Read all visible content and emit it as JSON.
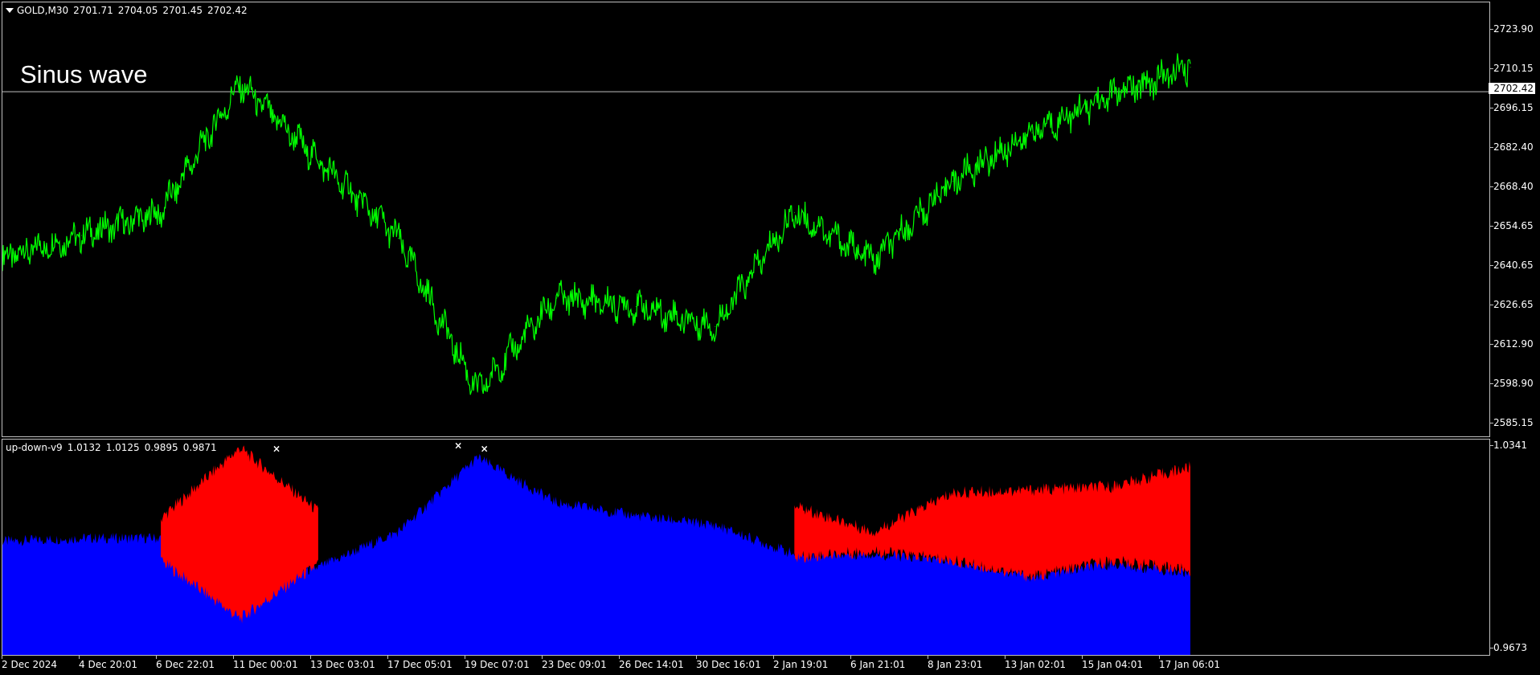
{
  "price_chart": {
    "symbol": "GOLD,M30",
    "ohlc": [
      "2701.71",
      "2704.05",
      "2701.45",
      "2702.42"
    ],
    "label": "Sinus wave",
    "current_price": "2702.42",
    "y_ticks": [
      "2723.90",
      "2710.15",
      "2696.15",
      "2682.40",
      "2668.40",
      "2654.65",
      "2640.65",
      "2626.65",
      "2612.90",
      "2598.90",
      "2585.15"
    ],
    "line_color": "#00ff00"
  },
  "indicator": {
    "name": "up-down-v9",
    "values": [
      "1.0132",
      "1.0125",
      "0.9895",
      "0.9871"
    ],
    "y_max": "1.0341",
    "y_min": "0.9673",
    "up_color": "#0000ff",
    "down_color": "#ff0000",
    "marker_color": "#ffffff"
  },
  "x_axis": {
    "labels": [
      "2 Dec 2024",
      "4 Dec 20:01",
      "6 Dec 22:01",
      "11 Dec 00:01",
      "13 Dec 03:01",
      "17 Dec 05:01",
      "19 Dec 07:01",
      "23 Dec 09:01",
      "26 Dec 14:01",
      "30 Dec 16:01",
      "2 Jan 19:01",
      "6 Jan 21:01",
      "8 Jan 23:01",
      "13 Jan 02:01",
      "15 Jan 04:01",
      "17 Jan 06:01"
    ]
  },
  "chart_data": {
    "type": "line",
    "title": "Sinus wave",
    "ylim": [
      2585.15,
      2723.9
    ],
    "x": [
      "2 Dec 2024",
      "4 Dec 20:01",
      "6 Dec 22:01",
      "11 Dec 00:01",
      "13 Dec 03:01",
      "17 Dec 05:01",
      "19 Dec 07:01",
      "23 Dec 09:01",
      "26 Dec 14:01",
      "30 Dec 16:01",
      "2 Jan 19:01",
      "6 Jan 21:01",
      "8 Jan 23:01",
      "13 Jan 02:01",
      "15 Jan 04:01",
      "17 Jan 06:01"
    ],
    "series": [
      {
        "name": "GOLD,M30",
        "values": [
          2644,
          2652,
          2660,
          2705,
          2678,
          2651,
          2597,
          2630,
          2627,
          2620,
          2660,
          2643,
          2671,
          2688,
          2701,
          2711
        ]
      }
    ],
    "indicator": {
      "ylim": [
        0.9673,
        1.0341
      ],
      "blue_level": [
        1.003,
        1.004,
        1.004,
        0.988,
        0.995,
        1.006,
        1.029,
        1.015,
        1.011,
        1.008,
        0.999,
        0.999,
        0.997,
        0.992,
        0.996,
        0.993
      ],
      "red_upper": [
        null,
        null,
        1.01,
        1.032,
        1.012,
        null,
        null,
        null,
        null,
        null,
        1.014,
        1.006,
        1.018,
        1.019,
        1.02,
        1.026
      ],
      "red_lower": [
        null,
        null,
        0.997,
        0.979,
        0.996,
        null,
        null,
        null,
        null,
        null,
        0.998,
        1.0,
        0.997,
        0.992,
        0.997,
        0.994
      ]
    }
  }
}
